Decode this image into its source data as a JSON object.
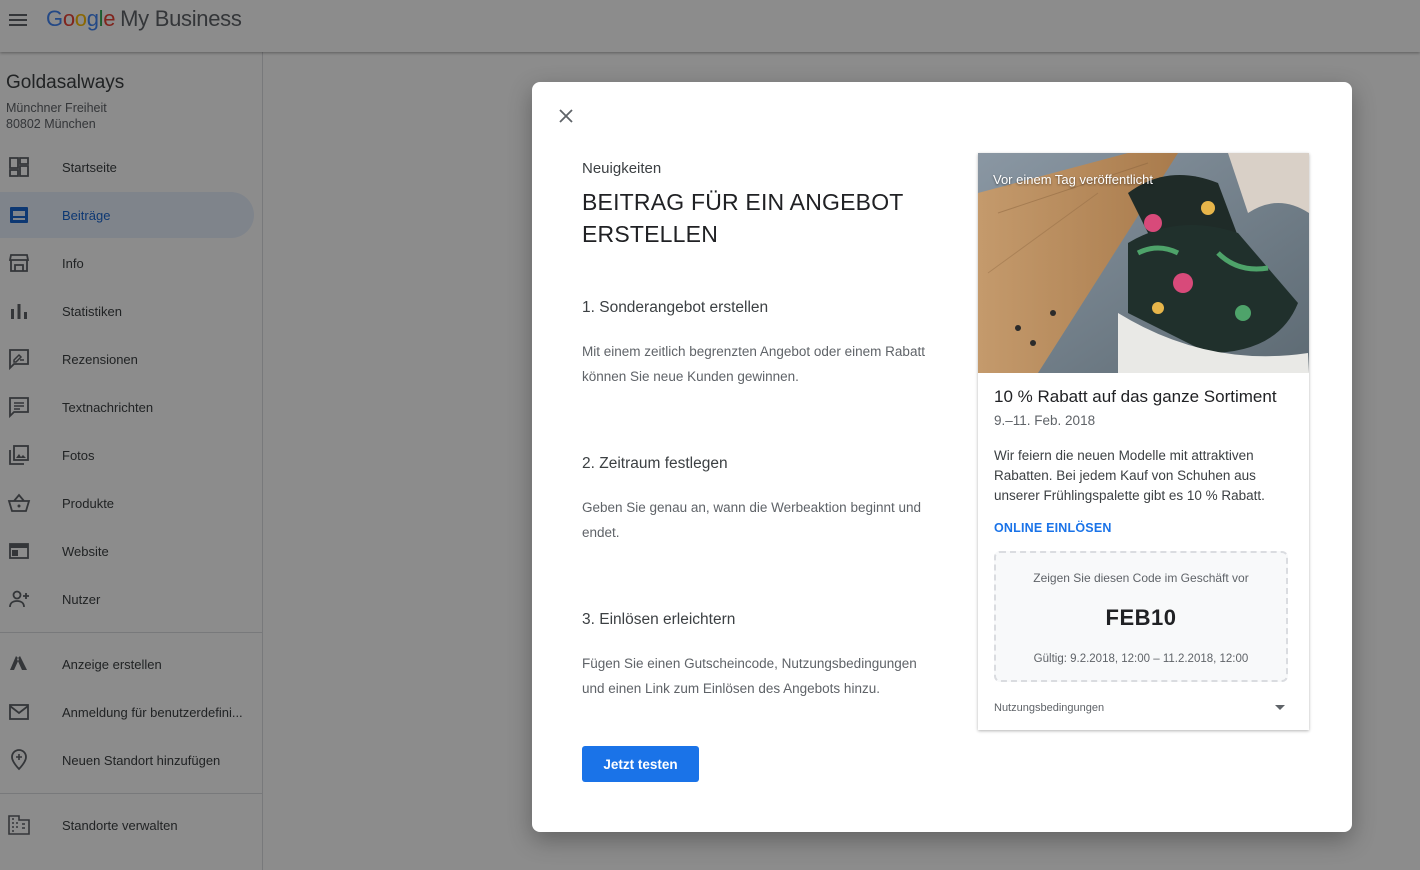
{
  "appbar": {
    "logo_letters": [
      "G",
      "o",
      "o",
      "g",
      "l",
      "e"
    ],
    "product": "My Business"
  },
  "business": {
    "name": "Goldasalways",
    "address_line1": "Münchner Freiheit",
    "address_line2": "80802 München"
  },
  "sidebar": {
    "items": [
      {
        "label": "Startseite",
        "icon": "dashboard-icon"
      },
      {
        "label": "Beiträge",
        "icon": "posts-icon",
        "active": true
      },
      {
        "label": "Info",
        "icon": "storefront-icon"
      },
      {
        "label": "Statistiken",
        "icon": "bar-chart-icon"
      },
      {
        "label": "Rezensionen",
        "icon": "rate-review-icon"
      },
      {
        "label": "Textnachrichten",
        "icon": "message-icon"
      },
      {
        "label": "Fotos",
        "icon": "photo-library-icon"
      },
      {
        "label": "Produkte",
        "icon": "basket-icon"
      },
      {
        "label": "Website",
        "icon": "web-icon"
      },
      {
        "label": "Nutzer",
        "icon": "add-person-icon"
      },
      {
        "label": "Anzeige erstellen",
        "icon": "ads-icon"
      },
      {
        "label": "Anmeldung für benutzerdefini...",
        "icon": "mail-icon"
      },
      {
        "label": "Neuen Standort hinzufügen",
        "icon": "add-location-icon"
      },
      {
        "label": "Standorte verwalten",
        "icon": "domain-icon"
      }
    ]
  },
  "dialog": {
    "eyebrow": "Neuigkeiten",
    "title": "BEITRAG FÜR EIN ANGEBOT ERSTELLEN",
    "steps": [
      {
        "title": "1. Sonderangebot erstellen",
        "text": "Mit einem zeitlich begrenzten Angebot oder einem Rabatt können Sie neue Kunden gewinnen."
      },
      {
        "title": "2. Zeitraum festlegen",
        "text": "Geben Sie genau an, wann die Werbeaktion beginnt und endet."
      },
      {
        "title": "3. Einlösen erleichtern",
        "text": "Fügen Sie einen Gutscheincode, Nutzungsbedingungen und einen Link zum Einlösen des Angebots hinzu."
      }
    ],
    "cta_label": "Jetzt testen",
    "preview": {
      "image_label": "Vor einem Tag veröffentlicht",
      "offer_title": "10 % Rabatt auf das ganze Sortiment",
      "offer_dates": "9.–11. Feb. 2018",
      "offer_description": "Wir feiern die neuen Modelle mit attraktiven Rabatten. Bei jedem Kauf von Schuhen aus unserer Frühlingspalette gibt es 10 % Rabatt.",
      "redeem_label": "ONLINE EINLÖSEN",
      "code_hint": "Zeigen Sie diesen Code im Geschäft vor",
      "code": "FEB10",
      "code_validity": "Gültig: 9.2.2018, 12:00 – 11.2.2018, 12:00",
      "terms_label": "Nutzungsbedingungen"
    }
  },
  "colors": {
    "accent": "#1a73e8",
    "active_bg": "#e8f0fe",
    "scrim": "rgba(0,0,0,0.45)"
  }
}
